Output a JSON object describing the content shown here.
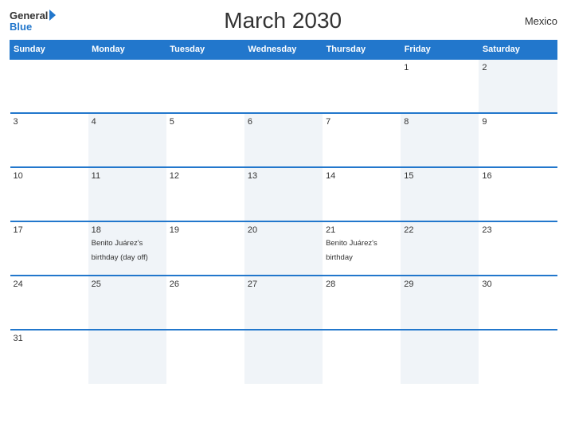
{
  "header": {
    "logo_general": "General",
    "logo_blue": "Blue",
    "title": "March 2030",
    "country": "Mexico"
  },
  "weekdays": [
    "Sunday",
    "Monday",
    "Tuesday",
    "Wednesday",
    "Thursday",
    "Friday",
    "Saturday"
  ],
  "weeks": [
    [
      {
        "day": "",
        "bg": false,
        "event": ""
      },
      {
        "day": "",
        "bg": false,
        "event": ""
      },
      {
        "day": "",
        "bg": false,
        "event": ""
      },
      {
        "day": "",
        "bg": false,
        "event": ""
      },
      {
        "day": "",
        "bg": false,
        "event": ""
      },
      {
        "day": "1",
        "bg": false,
        "event": ""
      },
      {
        "day": "2",
        "bg": true,
        "event": ""
      }
    ],
    [
      {
        "day": "3",
        "bg": false,
        "event": ""
      },
      {
        "day": "4",
        "bg": true,
        "event": ""
      },
      {
        "day": "5",
        "bg": false,
        "event": ""
      },
      {
        "day": "6",
        "bg": true,
        "event": ""
      },
      {
        "day": "7",
        "bg": false,
        "event": ""
      },
      {
        "day": "8",
        "bg": true,
        "event": ""
      },
      {
        "day": "9",
        "bg": false,
        "event": ""
      }
    ],
    [
      {
        "day": "10",
        "bg": false,
        "event": ""
      },
      {
        "day": "11",
        "bg": true,
        "event": ""
      },
      {
        "day": "12",
        "bg": false,
        "event": ""
      },
      {
        "day": "13",
        "bg": true,
        "event": ""
      },
      {
        "day": "14",
        "bg": false,
        "event": ""
      },
      {
        "day": "15",
        "bg": true,
        "event": ""
      },
      {
        "day": "16",
        "bg": false,
        "event": ""
      }
    ],
    [
      {
        "day": "17",
        "bg": false,
        "event": ""
      },
      {
        "day": "18",
        "bg": true,
        "event": "Benito Juárez's birthday (day off)"
      },
      {
        "day": "19",
        "bg": false,
        "event": ""
      },
      {
        "day": "20",
        "bg": true,
        "event": ""
      },
      {
        "day": "21",
        "bg": false,
        "event": "Benito Juárez's birthday"
      },
      {
        "day": "22",
        "bg": true,
        "event": ""
      },
      {
        "day": "23",
        "bg": false,
        "event": ""
      }
    ],
    [
      {
        "day": "24",
        "bg": false,
        "event": ""
      },
      {
        "day": "25",
        "bg": true,
        "event": ""
      },
      {
        "day": "26",
        "bg": false,
        "event": ""
      },
      {
        "day": "27",
        "bg": true,
        "event": ""
      },
      {
        "day": "28",
        "bg": false,
        "event": ""
      },
      {
        "day": "29",
        "bg": true,
        "event": ""
      },
      {
        "day": "30",
        "bg": false,
        "event": ""
      }
    ],
    [
      {
        "day": "31",
        "bg": false,
        "event": ""
      },
      {
        "day": "",
        "bg": true,
        "event": ""
      },
      {
        "day": "",
        "bg": false,
        "event": ""
      },
      {
        "day": "",
        "bg": true,
        "event": ""
      },
      {
        "day": "",
        "bg": false,
        "event": ""
      },
      {
        "day": "",
        "bg": true,
        "event": ""
      },
      {
        "day": "",
        "bg": false,
        "event": ""
      }
    ]
  ]
}
